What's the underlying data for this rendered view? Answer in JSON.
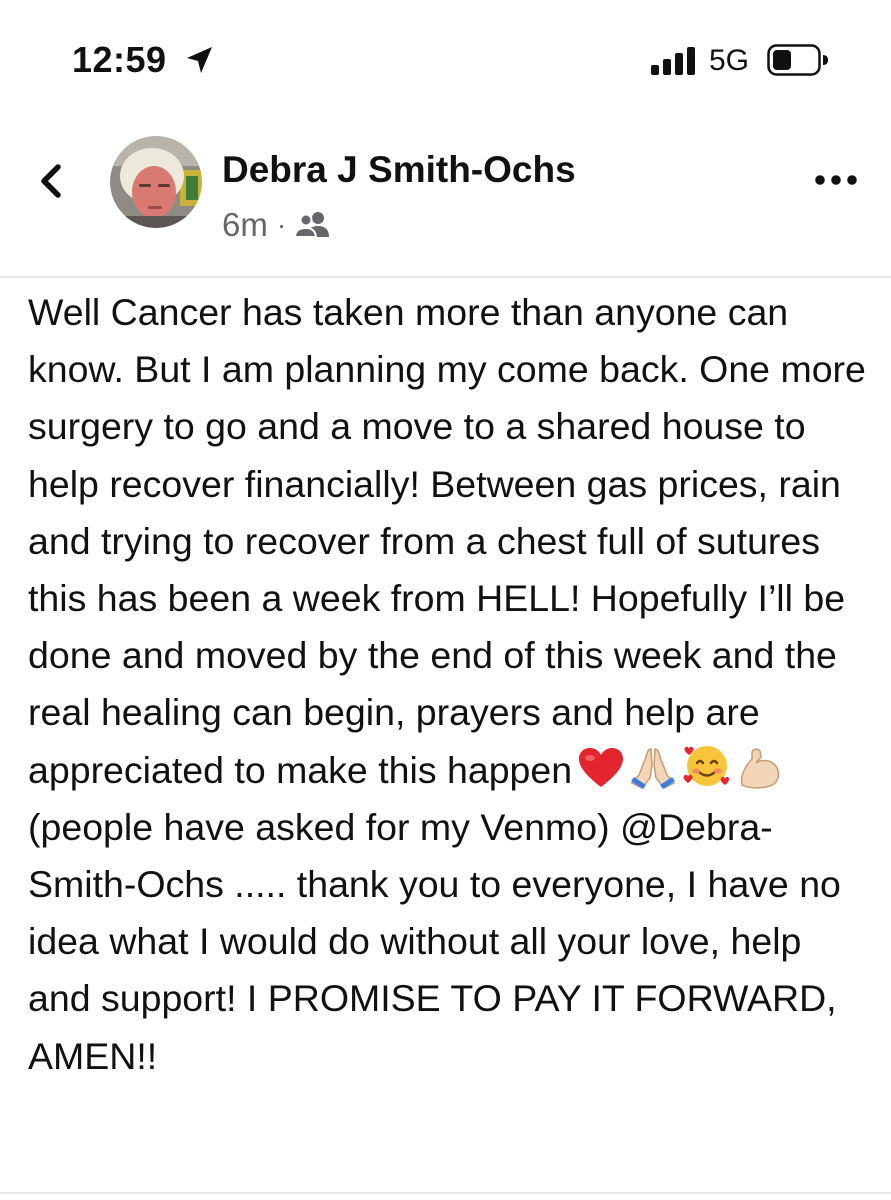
{
  "status_bar": {
    "time": "12:59",
    "network": "5G",
    "icons": [
      "location-arrow-icon",
      "cellular-signal-icon",
      "battery-icon"
    ]
  },
  "post": {
    "author_name": "Debra J Smith-Ochs",
    "timestamp": "6m",
    "meta_separator": "·",
    "audience": "friends-icon",
    "body_part1": "Well Cancer has taken more than anyone can know. But I am planning my come back. One more surgery to go and a move to a shared house to help recover financially! Between gas prices, rain and trying to recover from a chest full of sutures this has been a week from HELL! Hopefully I’ll be done and moved by the end of this week and the real healing can begin, prayers and help are appreciated to make this happen",
    "emojis": [
      "red-heart-emoji",
      "folded-hands-emoji",
      "smiling-face-with-hearts-emoji",
      "flexed-biceps-emoji"
    ],
    "body_part2": "(people have asked for my Venmo) @Debra-Smith-Ochs ..... thank you to everyone, I have no idea what I would do without all your love, help and support! I PROMISE TO PAY IT FORWARD, AMEN!!"
  },
  "colors": {
    "text": "#111111",
    "secondary_text": "#65676b",
    "divider": "#e4e6ea",
    "background": "#ffffff"
  }
}
